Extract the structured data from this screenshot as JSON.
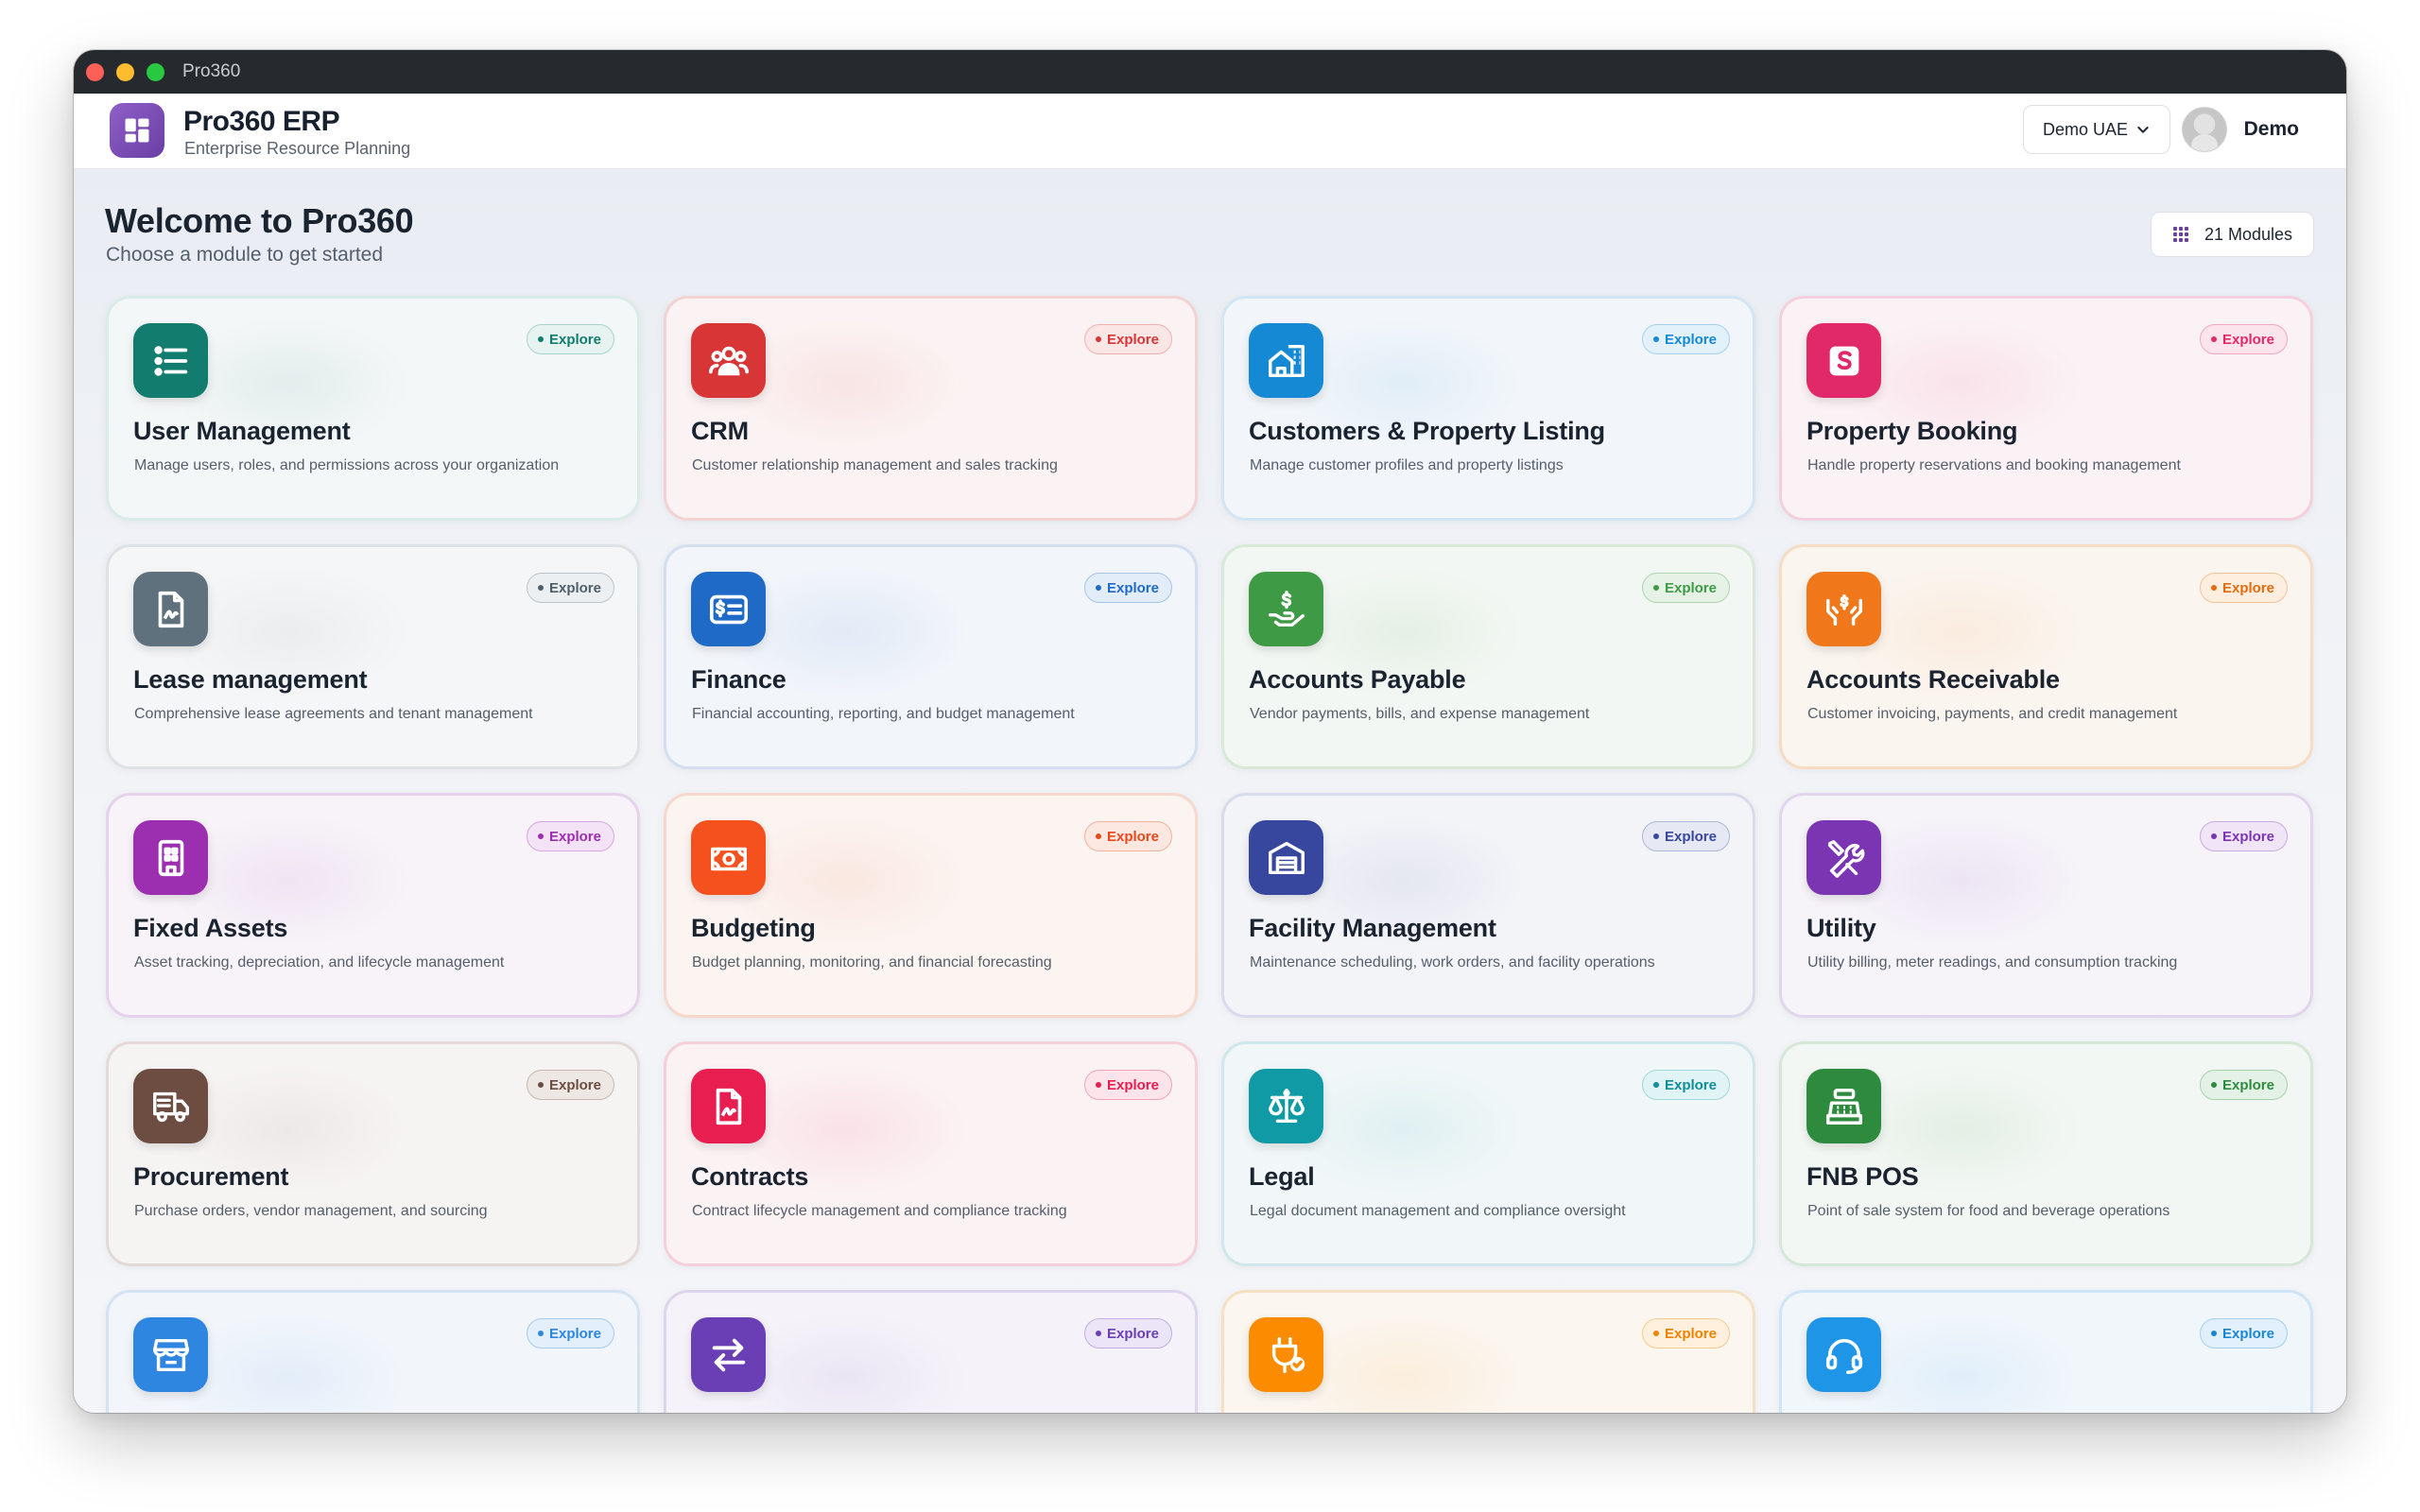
{
  "window": {
    "title": "Pro360"
  },
  "header": {
    "app_name": "Pro360 ERP",
    "app_subtitle": "Enterprise Resource Planning",
    "company": "Demo UAE",
    "user": "Demo"
  },
  "main": {
    "welcome": "Welcome to Pro360",
    "subtitle": "Choose a module to get started",
    "modules_count": "21 Modules"
  },
  "modules": [
    {
      "title": "User Management",
      "desc": "Manage users, roles, and permissions across your organization",
      "explore": "Explore",
      "icon": "list-icon",
      "color": "#127c6e"
    },
    {
      "title": "CRM",
      "desc": "Customer relationship management and sales tracking",
      "explore": "Explore",
      "icon": "users-icon",
      "color": "#d83636"
    },
    {
      "title": "Customers & Property Listing",
      "desc": "Manage customer profiles and property listings",
      "explore": "Explore",
      "icon": "house-building-icon",
      "color": "#1589d3"
    },
    {
      "title": "Property Booking",
      "desc": "Handle property reservations and booking management",
      "explore": "Explore",
      "icon": "booking-icon",
      "color": "#e12868"
    },
    {
      "title": "Lease management",
      "desc": "Comprehensive lease agreements and tenant management",
      "explore": "Explore",
      "icon": "document-icon",
      "color": "#5f717c"
    },
    {
      "title": "Finance",
      "desc": "Financial accounting, reporting, and budget management",
      "explore": "Explore",
      "icon": "money-card-icon",
      "color": "#1f6ac7"
    },
    {
      "title": "Accounts Payable",
      "desc": "Vendor payments, bills, and expense management",
      "explore": "Explore",
      "icon": "hand-dollar-icon",
      "color": "#3f9a45"
    },
    {
      "title": "Accounts Receivable",
      "desc": "Customer invoicing, payments, and credit management",
      "explore": "Explore",
      "icon": "hands-money-icon",
      "color": "#f0781a"
    },
    {
      "title": "Fixed Assets",
      "desc": "Asset tracking, depreciation, and lifecycle management",
      "explore": "Explore",
      "icon": "building-icon",
      "color": "#9c2fb0"
    },
    {
      "title": "Budgeting",
      "desc": "Budget planning, monitoring, and financial forecasting",
      "explore": "Explore",
      "icon": "cash-icon",
      "color": "#f4511e"
    },
    {
      "title": "Facility Management",
      "desc": "Maintenance scheduling, work orders, and facility operations",
      "explore": "Explore",
      "icon": "warehouse-icon",
      "color": "#38479e"
    },
    {
      "title": "Utility",
      "desc": "Utility billing, meter readings, and consumption tracking",
      "explore": "Explore",
      "icon": "tools-icon",
      "color": "#7b35b2"
    },
    {
      "title": "Procurement",
      "desc": "Purchase orders, vendor management, and sourcing",
      "explore": "Explore",
      "icon": "truck-icon",
      "color": "#6d4c41"
    },
    {
      "title": "Contracts",
      "desc": "Contract lifecycle management and compliance tracking",
      "explore": "Explore",
      "icon": "contract-icon",
      "color": "#e91e50"
    },
    {
      "title": "Legal",
      "desc": "Legal document management and compliance oversight",
      "explore": "Explore",
      "icon": "scales-icon",
      "color": "#0f9aa6"
    },
    {
      "title": "FNB POS",
      "desc": "Point of sale system for food and beverage operations",
      "explore": "Explore",
      "icon": "cash-register-icon",
      "color": "#2e8b3e"
    },
    {
      "title": "",
      "desc": "",
      "explore": "Explore",
      "icon": "store-icon",
      "color": "#2f86e0"
    },
    {
      "title": "",
      "desc": "",
      "explore": "Explore",
      "icon": "transfer-icon",
      "color": "#6a3fb5"
    },
    {
      "title": "",
      "desc": "",
      "explore": "Explore",
      "icon": "plug-check-icon",
      "color": "#fb8c00"
    },
    {
      "title": "",
      "desc": "",
      "explore": "Explore",
      "icon": "headset-icon",
      "color": "#1e95e6"
    }
  ]
}
